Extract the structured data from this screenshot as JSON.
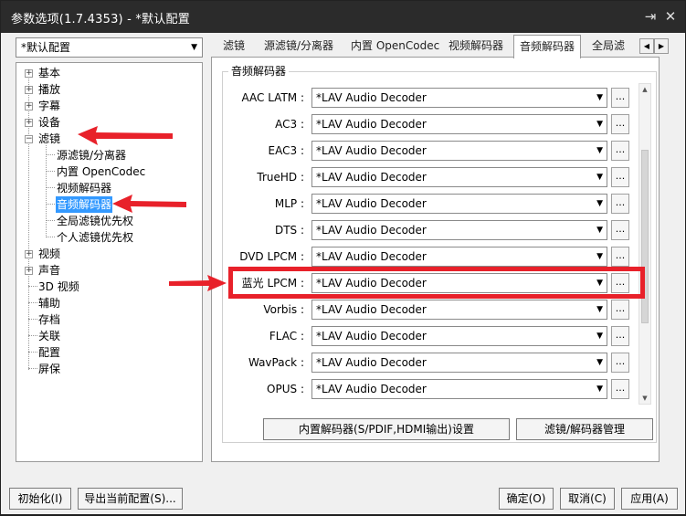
{
  "window": {
    "title": "参数选项(1.7.4353) - *默认配置",
    "pin_icon": "⇥",
    "close_icon": "✕"
  },
  "profile": {
    "selected": "*默认配置"
  },
  "tree": {
    "items": [
      {
        "label": "基本",
        "expander": "+"
      },
      {
        "label": "播放",
        "expander": "+"
      },
      {
        "label": "字幕",
        "expander": "+"
      },
      {
        "label": "设备",
        "expander": "+"
      },
      {
        "label": "滤镜",
        "expander": "−"
      },
      {
        "label": "源滤镜/分离器"
      },
      {
        "label": "内置 OpenCodec"
      },
      {
        "label": "视频解码器"
      },
      {
        "label": "音频解码器"
      },
      {
        "label": "全局滤镜优先权"
      },
      {
        "label": "个人滤镜优先权"
      },
      {
        "label": "视频",
        "expander": "+"
      },
      {
        "label": "声音",
        "expander": "+"
      },
      {
        "label": "3D 视频"
      },
      {
        "label": "辅助"
      },
      {
        "label": "存档"
      },
      {
        "label": "关联"
      },
      {
        "label": "配置"
      },
      {
        "label": "屏保"
      }
    ]
  },
  "tabs": [
    "滤镜",
    "源滤镜/分离器",
    "内置 OpenCodec",
    "视频解码器",
    "音频解码器",
    "全局滤镜"
  ],
  "tab_scroll": {
    "left": "◀",
    "right": "▶"
  },
  "group": {
    "title": "音频解码器"
  },
  "decoders": [
    {
      "label": "AAC LATM :",
      "value": "*LAV Audio Decoder"
    },
    {
      "label": "AC3 :",
      "value": "*LAV Audio Decoder"
    },
    {
      "label": "EAC3 :",
      "value": "*LAV Audio Decoder"
    },
    {
      "label": "TrueHD :",
      "value": "*LAV Audio Decoder"
    },
    {
      "label": "MLP :",
      "value": "*LAV Audio Decoder"
    },
    {
      "label": "DTS :",
      "value": "*LAV Audio Decoder"
    },
    {
      "label": "DVD LPCM :",
      "value": "*LAV Audio Decoder"
    },
    {
      "label": "蓝光 LPCM :",
      "value": "*LAV Audio Decoder"
    },
    {
      "label": "Vorbis :",
      "value": "*LAV Audio Decoder"
    },
    {
      "label": "FLAC :",
      "value": "*LAV Audio Decoder"
    },
    {
      "label": "WavPack :",
      "value": "*LAV Audio Decoder"
    },
    {
      "label": "OPUS :",
      "value": "*LAV Audio Decoder"
    }
  ],
  "dots_label": "...",
  "panel_buttons": {
    "builtin": "内置解码器(S/PDIF,HDMI输出)设置",
    "manage": "滤镜/解码器管理"
  },
  "footer": {
    "init": "初始化(I)",
    "export": "导出当前配置(S)...",
    "ok": "确定(O)",
    "cancel": "取消(C)",
    "apply": "应用(A)"
  },
  "colors": {
    "highlight": "#e8212a",
    "selection": "#3399ff",
    "titlebar": "#2b2b2b"
  }
}
